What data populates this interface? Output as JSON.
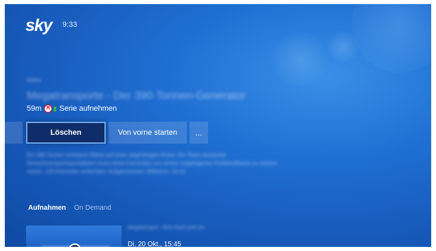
{
  "header": {
    "logo": "sky",
    "time": "9:33"
  },
  "detail": {
    "genre": "Reihe",
    "title": "Megatransporte - Der 390-Tonnen-Generator",
    "duration": "59m",
    "record_badge": "R",
    "record_label": "Serie aufnehmen",
    "description": "Ein 390 Tonnen schwerer Riese auf einer waghalsigen Reise: Ein Team deutscher Schwertransportspezialisten muss einen Generator von einem ostgelegenen Kohlekraftwerk zu seinem neuen. 120 Kilometer entfernten. Aufgenommen: Mittwoch, 15:10"
  },
  "actions": {
    "delete_label": "Löschen",
    "restart_label": "Von vorne starten",
    "more_label": "..."
  },
  "tabs": [
    {
      "label": "Aufnahmen",
      "active": true
    },
    {
      "label": "On Demand",
      "active": false
    }
  ],
  "episode": {
    "title": "Megatransport - Eine Stadt zieht um",
    "date": "Di. 20 Okt., 15:45"
  }
}
